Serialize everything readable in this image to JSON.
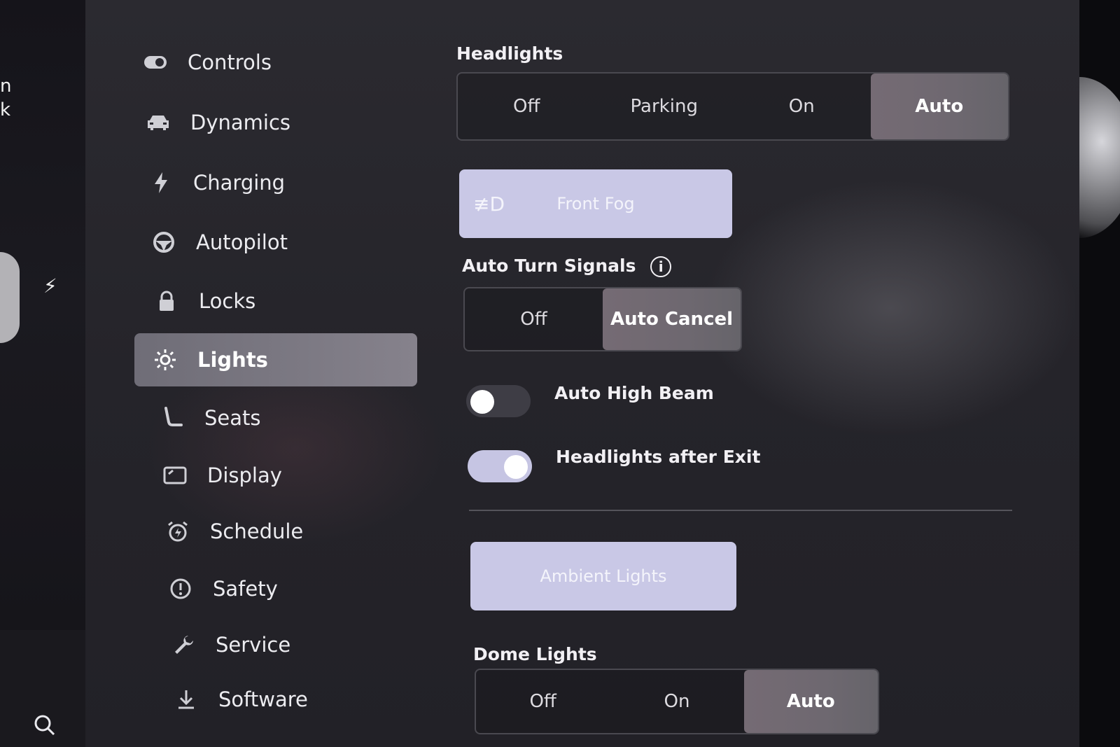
{
  "edge": {
    "left_text_fragment_1": "n",
    "left_text_fragment_2": "k"
  },
  "sidebar": {
    "items": [
      {
        "label": "Controls",
        "icon": "toggle-icon"
      },
      {
        "label": "Dynamics",
        "icon": "car-icon"
      },
      {
        "label": "Charging",
        "icon": "bolt-icon"
      },
      {
        "label": "Autopilot",
        "icon": "steering-wheel-icon"
      },
      {
        "label": "Locks",
        "icon": "lock-icon"
      },
      {
        "label": "Lights",
        "icon": "sun-icon",
        "active": true
      },
      {
        "label": "Seats",
        "icon": "seat-icon"
      },
      {
        "label": "Display",
        "icon": "display-icon"
      },
      {
        "label": "Schedule",
        "icon": "alarm-clock-icon"
      },
      {
        "label": "Safety",
        "icon": "alert-circle-icon"
      },
      {
        "label": "Service",
        "icon": "wrench-icon"
      },
      {
        "label": "Software",
        "icon": "download-icon"
      }
    ]
  },
  "headlights": {
    "title": "Headlights",
    "options": [
      "Off",
      "Parking",
      "On",
      "Auto"
    ],
    "selected": "Auto"
  },
  "front_fog": {
    "icon_glyph": "≢D",
    "label": "Front Fog"
  },
  "auto_turn_signals": {
    "title": "Auto Turn Signals",
    "info_glyph": "i",
    "options": [
      "Off",
      "Auto Cancel"
    ],
    "selected": "Auto Cancel"
  },
  "toggles": {
    "auto_high_beam": {
      "label": "Auto High Beam",
      "on": false
    },
    "headlights_after_exit": {
      "label": "Headlights after Exit",
      "on": true
    }
  },
  "ambient_lights": {
    "label": "Ambient Lights"
  },
  "dome_lights": {
    "title": "Dome Lights",
    "options": [
      "Off",
      "On",
      "Auto"
    ],
    "selected": "Auto"
  },
  "colors": {
    "accent_toggle_on": "#c6c5e3",
    "button_light": "#c9c8e6",
    "selected_segment": "#756b74",
    "sidebar_active": "#7c7983"
  }
}
